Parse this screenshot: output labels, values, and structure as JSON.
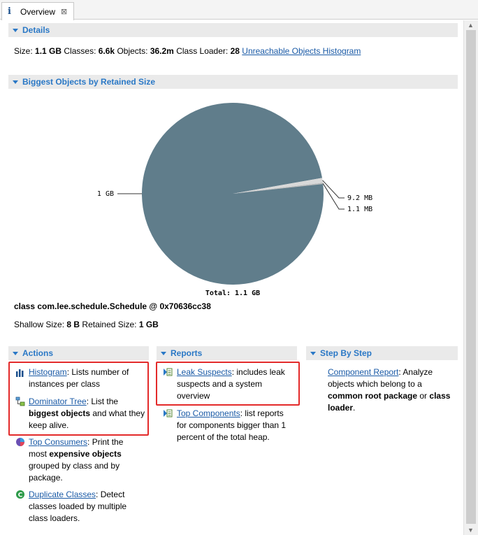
{
  "tab": {
    "icon": "info-icon",
    "title": "Overview",
    "close": "⊠"
  },
  "details": {
    "header": "Details",
    "size_label": "Size:",
    "size": "1.1 GB",
    "classes_label": "Classes:",
    "classes": "6.6k",
    "objects_label": "Objects:",
    "objects": "36.2m",
    "loader_label": "Class Loader:",
    "loader": "28",
    "link": "Unreachable Objects Histogram"
  },
  "biggest": {
    "header": "Biggest Objects by Retained Size",
    "object_class": "class com.lee.schedule.Schedule @ 0x70636cc38",
    "shallow_label": "Shallow Size:",
    "shallow": "8 B",
    "retained_label": "Retained Size:",
    "retained": "1 GB"
  },
  "chart_data": {
    "type": "pie",
    "slices": [
      {
        "label": "1 GB",
        "value": 1024,
        "color": "#607d8b"
      },
      {
        "label": "9.2 MB",
        "value": 9.2,
        "color": "#d9d9d9"
      },
      {
        "label": "1.1 MB",
        "value": 1.1,
        "color": "#bfbfbf"
      }
    ],
    "total": "Total: 1.1 GB"
  },
  "actions": {
    "header": "Actions",
    "histogram_link": "Histogram",
    "histogram_desc": ": Lists number of instances per class",
    "dominator_link": "Dominator Tree",
    "dominator_desc1": ": List the",
    "dominator_bold": "biggest objects",
    "dominator_desc2": "and what they keep alive.",
    "consumers_link": "Top Consumers",
    "consumers_desc1": ": Print the most",
    "consumers_bold": "expensive objects",
    "consumers_desc2": "grouped by class and by package.",
    "duplicate_link": "Duplicate Classes",
    "duplicate_desc": ": Detect classes loaded by multiple class loaders."
  },
  "reports": {
    "header": "Reports",
    "leak_link": "Leak Suspects",
    "leak_desc": ": includes leak suspects and a system overview",
    "components_link": "Top Components",
    "components_desc": ": list reports for components bigger than 1 percent of the total heap."
  },
  "stepbystep": {
    "header": "Step By Step",
    "component_link": "Component Report",
    "component_desc1": ": Analyze objects which belong to a",
    "component_bold1": "common root package",
    "component_or": "or",
    "component_bold2": "class loader",
    "component_end": "."
  },
  "colors": {
    "accent": "#2a78c6",
    "link": "#1a5aa6",
    "pie": "#607d8b",
    "highlight": "#e32a2a"
  }
}
